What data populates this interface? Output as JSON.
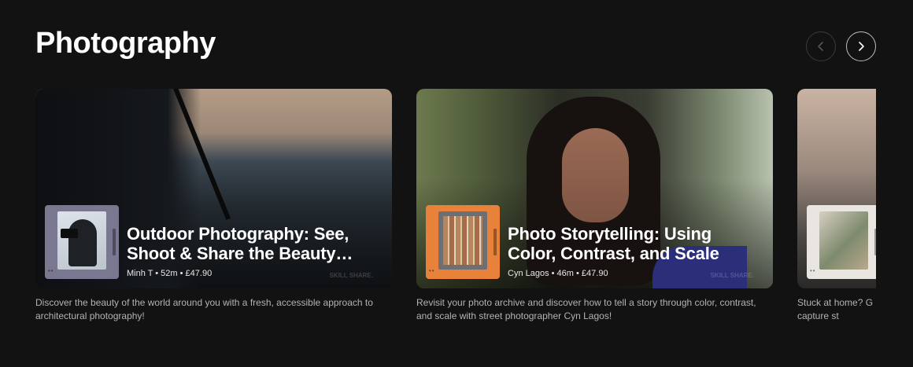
{
  "section": {
    "title": "Photography"
  },
  "nav": {
    "prev_icon": "chevron-left-icon",
    "next_icon": "chevron-right-icon"
  },
  "courses": [
    {
      "title": "Outdoor Photography: See, Shoot & Share the Beauty…",
      "meta": "Minh T • 52m • £47.90",
      "watermark": "SKILL SHARE.",
      "description": "Discover the beauty of the world around you with a fresh, accessible approach to architectural photography!",
      "thumb_color": "#7a7790"
    },
    {
      "title": "Photo Storytelling: Using Color, Contrast, and Scale",
      "meta": "Cyn Lagos • 46m • £47.90",
      "watermark": "SKILL SHARE.",
      "description": "Revisit your photo archive and discover how to tell a story through color, contrast, and scale with street photographer Cyn Lagos!",
      "thumb_color": "#e8823a"
    },
    {
      "title": "",
      "meta": "",
      "watermark": "",
      "description": "Stuck at home? G how to capture st",
      "thumb_color": "#e9e6e1"
    }
  ],
  "colors": {
    "background": "#121212",
    "text_primary": "#ffffff",
    "text_secondary": "#b3b3b3"
  }
}
